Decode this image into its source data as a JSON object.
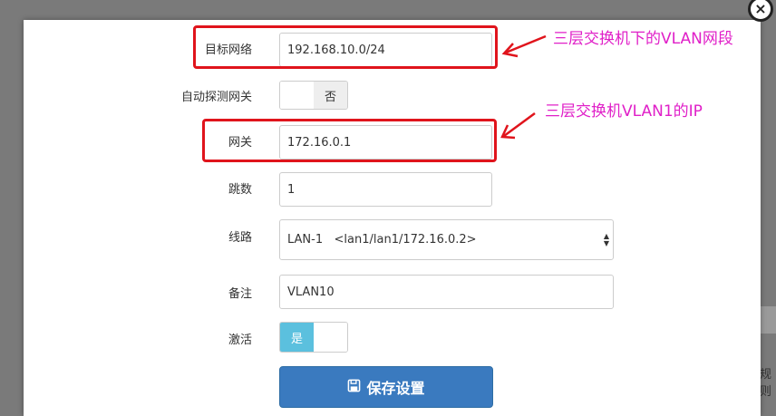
{
  "background": {
    "partial_text": "规则"
  },
  "modal": {
    "close_icon": "×",
    "fields": {
      "target_network": {
        "label": "目标网络",
        "value": "192.168.10.0/24"
      },
      "auto_detect_gateway": {
        "label": "自动探测网关",
        "toggle_value": "否"
      },
      "gateway": {
        "label": "网关",
        "value": "172.16.0.1"
      },
      "hops": {
        "label": "跳数",
        "value": "1"
      },
      "line": {
        "label": "线路",
        "selected": "LAN-1   <lan1/lan1/172.16.0.2>"
      },
      "remark": {
        "label": "备注",
        "value": "VLAN10"
      },
      "active": {
        "label": "激活",
        "toggle_value": "是"
      }
    },
    "save_button": {
      "label": "保存设置",
      "icon": "floppy-disk-icon"
    }
  },
  "annotations": {
    "note1": "三层交换机下的VLAN网段",
    "note2": "三层交换机VLAN1的IP"
  },
  "colors": {
    "accent": "#3a7abf",
    "toggle_on": "#5bc0de",
    "annotation": "#e020c8",
    "highlight_box": "#e0141c"
  }
}
